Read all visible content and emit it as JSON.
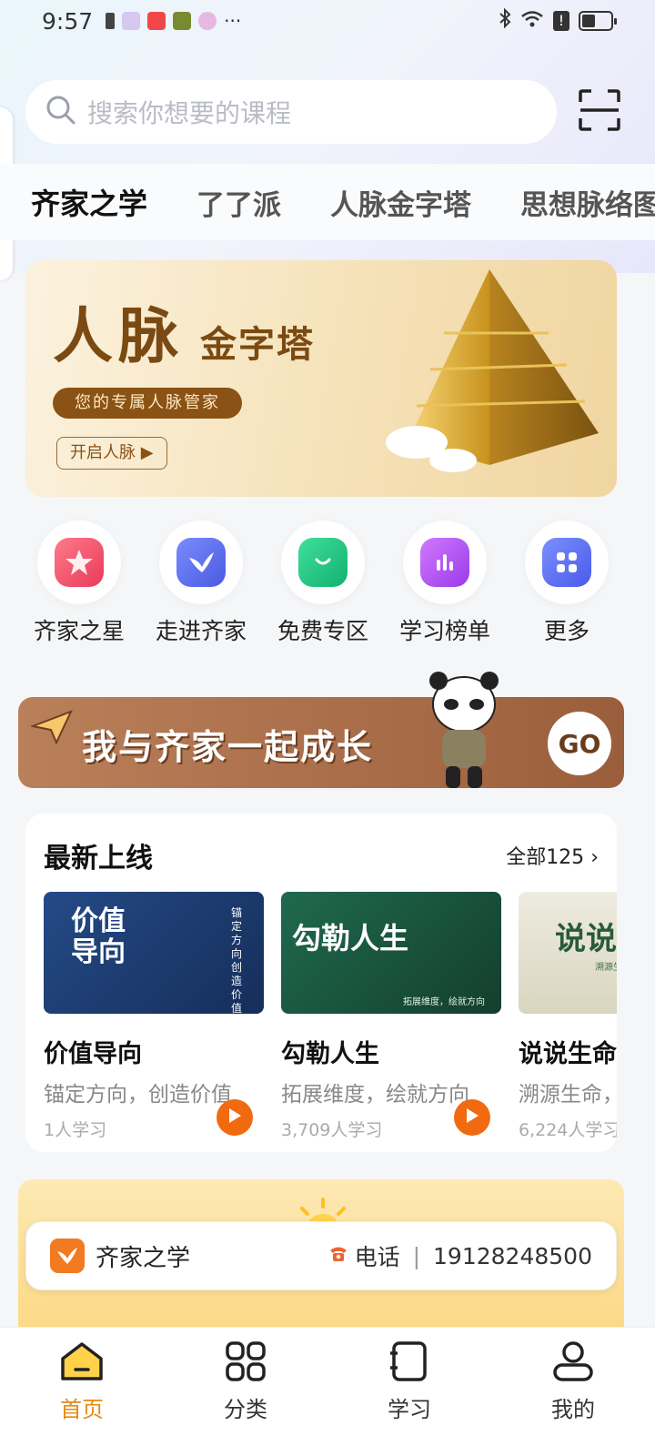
{
  "status_bar": {
    "time": "9:57",
    "ellipsis": "···"
  },
  "search": {
    "placeholder": "搜索你想要的课程"
  },
  "tabs": [
    {
      "label": "齐家之学",
      "active": true
    },
    {
      "label": "了了派",
      "active": false
    },
    {
      "label": "人脉金字塔",
      "active": false
    },
    {
      "label": "思想脉络图",
      "active": false
    }
  ],
  "banner": {
    "title_big": "人脉",
    "title_small": "金字塔",
    "subtitle": "您的专属人脉管家",
    "button": "开启人脉 ▶"
  },
  "quick_links": [
    {
      "label": "齐家之星",
      "icon": "star-icon",
      "color": "#f0506e"
    },
    {
      "label": "走进齐家",
      "icon": "bird-icon",
      "color": "#5a6ef0"
    },
    {
      "label": "免费专区",
      "icon": "bag-icon",
      "color": "#22c07a"
    },
    {
      "label": "学习榜单",
      "icon": "chart-icon",
      "color": "#b35af0"
    },
    {
      "label": "更多",
      "icon": "grid-icon",
      "color": "#5a74f0"
    }
  ],
  "growth_banner": {
    "text": "我与齐家一起成长",
    "button": "GO"
  },
  "new_courses": {
    "title": "最新上线",
    "more": "全部125",
    "items": [
      {
        "name": "价值导向",
        "desc": "锚定方向，创造价值",
        "count": "1人学习",
        "cover_title": "价值导向",
        "cover_side": "锚定方向 创造价值",
        "cover_color": "#1d3d74"
      },
      {
        "name": "勾勒人生",
        "desc": " 拓展维度，绘就方向",
        "count": "3,709人学习",
        "cover_title": "勾勒人生",
        "cover_side": "拓展维度，绘就方向",
        "cover_color": "#1e5a44"
      },
      {
        "name": "说说生命",
        "desc": "溯源生命，",
        "count": "6,224人学习",
        "cover_title": "说说",
        "cover_side": "溯源生",
        "cover_color": "#e8e6d4"
      }
    ]
  },
  "contact": {
    "name": "齐家之学",
    "phone_label": "电话",
    "phone": "19128248500"
  },
  "bottom_nav": [
    {
      "label": "首页",
      "icon": "home-icon",
      "active": true
    },
    {
      "label": "分类",
      "icon": "category-icon",
      "active": false
    },
    {
      "label": "学习",
      "icon": "notebook-icon",
      "active": false
    },
    {
      "label": "我的",
      "icon": "profile-icon",
      "active": false
    }
  ],
  "colors": {
    "accent": "#e68a12",
    "play": "#f26a10",
    "banner_brown": "#7a4a12"
  }
}
